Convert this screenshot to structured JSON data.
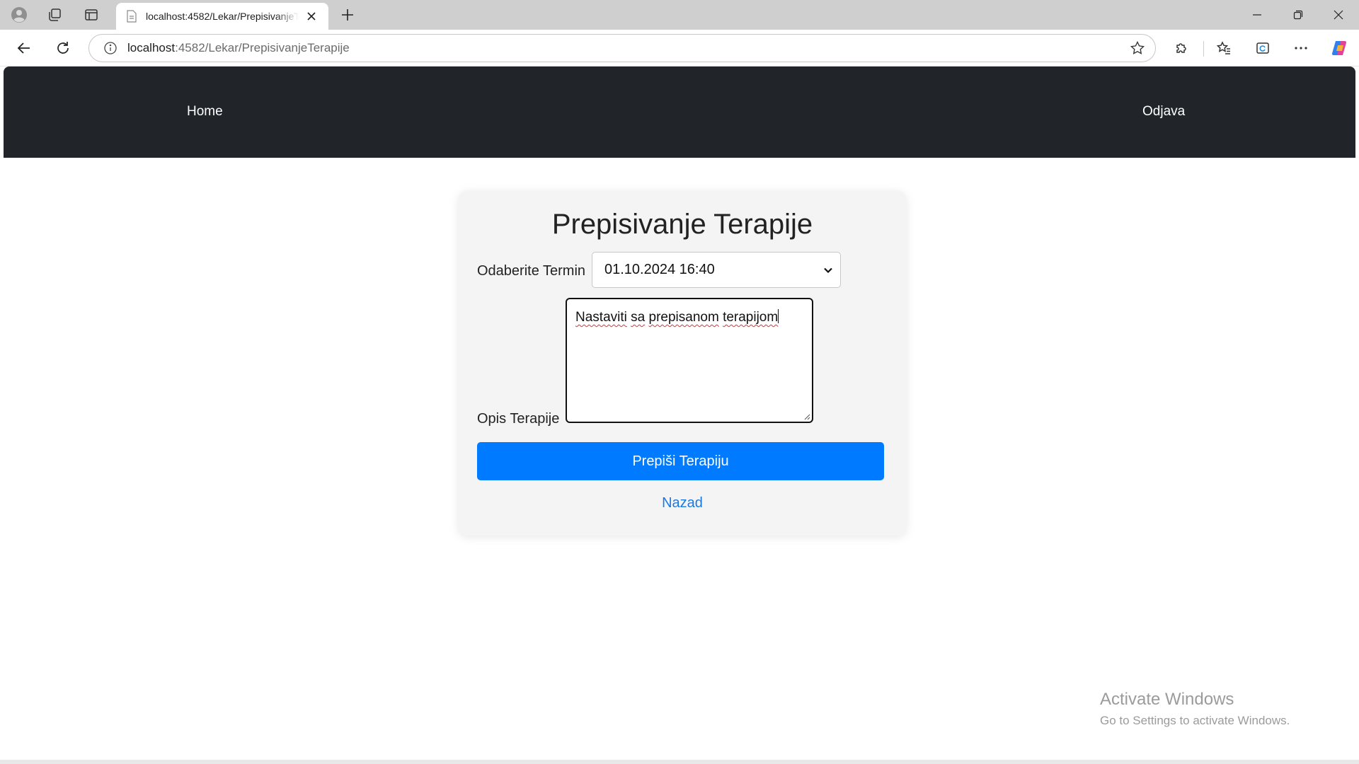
{
  "browser": {
    "tab_title": "localhost:4582/Lekar/PrepisivanjeTerapije",
    "url_host": "localhost",
    "url_rest": ":4582/Lekar/PrepisivanjeTerapije",
    "icons": {
      "profile": "profile-icon",
      "workspaces": "workspaces-icon",
      "tab_actions": "vertical-tabs-icon",
      "favicon": "page-icon",
      "close_tab": "close-icon",
      "new_tab": "plus-icon",
      "minimize": "minimize-icon",
      "restore": "restore-icon",
      "close_window": "close-icon",
      "back": "back-arrow-icon",
      "reload": "reload-icon",
      "site_info": "info-icon",
      "favorite": "star-icon",
      "extensions": "puzzle-icon",
      "favorites": "favorites-icon",
      "collections": "collections-icon",
      "more": "more-icon",
      "copilot": "copilot-icon"
    }
  },
  "navbar": {
    "home_label": "Home",
    "logout_label": "Odjava"
  },
  "form": {
    "title": "Prepisivanje Terapije",
    "termin_label": "Odaberite Termin",
    "termin_selected": "01.10.2024 16:40",
    "opis_label": "Opis Terapije",
    "opis_value_words": [
      "Nastaviti",
      "sa",
      "prepisanom",
      "terapijom"
    ],
    "submit_label": "Prepiši Terapiju",
    "back_label": "Nazad"
  },
  "watermark": {
    "line1": "Activate Windows",
    "line2": "Go to Settings to activate Windows."
  },
  "colors": {
    "navbar_bg": "#212529",
    "primary": "#007bff",
    "link": "#1a7ae0",
    "card_bg": "#f4f4f4"
  }
}
